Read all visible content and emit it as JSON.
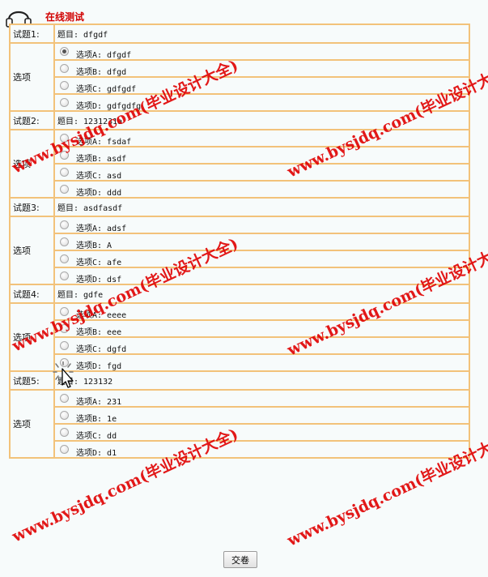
{
  "header": {
    "title": "在线测试"
  },
  "labels": {
    "options": "选项"
  },
  "questions": [
    {
      "num": "试题1:",
      "text": "题目: dfgdf",
      "options": [
        "选项A: dfgdf",
        "选项B: dfgd",
        "选项C: gdfgdf",
        "选项D: gdfgdfg"
      ],
      "selected": 0
    },
    {
      "num": "试题2:",
      "text": "题目: 1231231a",
      "options": [
        "选项A: fsdaf",
        "选项B: asdf",
        "选项C: asd",
        "选项D: ddd"
      ],
      "selected": -1
    },
    {
      "num": "试题3:",
      "text": "题目: asdfasdf",
      "options": [
        "选项A: adsf",
        "选项B: A",
        "选项C: afe",
        "选项D: dsf"
      ],
      "selected": -1
    },
    {
      "num": "试题4:",
      "text": "题目: gdfe",
      "options": [
        "选项A: eeee",
        "选项B: eee",
        "选项C: dgfd",
        "选项D: fgd"
      ],
      "selected": -1
    },
    {
      "num": "试题5:",
      "text": "题目: 123132",
      "options": [
        "选项A: 231",
        "选项B: 1e",
        "选项C: dd",
        "选项D: d1"
      ],
      "selected": -1
    }
  ],
  "submit_label": "交卷",
  "watermark_text": "www.bysjdq.com(毕业设计大全)",
  "colors": {
    "border": "#f2c27a",
    "title": "#d10000",
    "watermark": "#e00000",
    "background": "#f7fbfb"
  },
  "icons": {
    "header": "headphones-icon",
    "cursor": "cursor-pointer-icon"
  }
}
